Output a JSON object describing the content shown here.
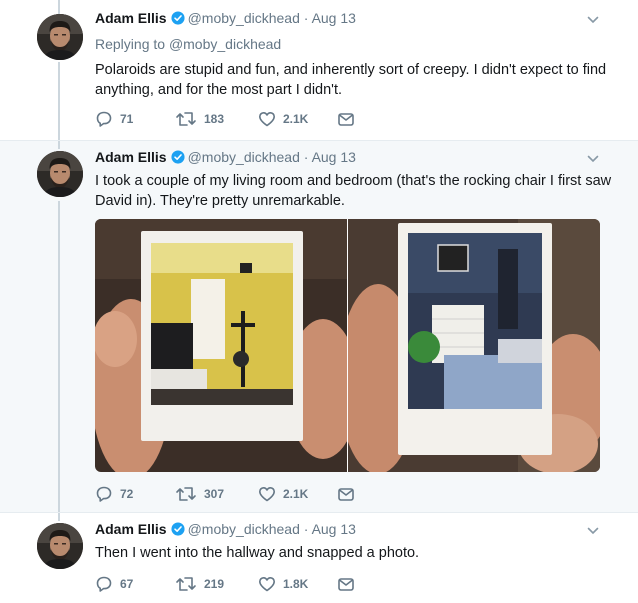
{
  "tweets": [
    {
      "author": "Adam Ellis",
      "handle": "@moby_dickhead",
      "date": "Aug 13",
      "replying_label": "Replying to",
      "replying_handle": "@moby_dickhead",
      "text": "Polaroids are stupid and fun, and inherently sort of creepy. I didn't expect to find anything, and for the most part I didn't.",
      "replies": "71",
      "retweets": "183",
      "likes": "2.1K"
    },
    {
      "author": "Adam Ellis",
      "handle": "@moby_dickhead",
      "date": "Aug 13",
      "text": "I took a couple of my living room and bedroom (that's the rocking chair I first saw David in). They're pretty unremarkable.",
      "replies": "72",
      "retweets": "307",
      "likes": "2.1K",
      "photos": [
        "photo-living-room-polaroid",
        "photo-bedroom-polaroid"
      ]
    },
    {
      "author": "Adam Ellis",
      "handle": "@moby_dickhead",
      "date": "Aug 13",
      "text": "Then I went into the hallway and snapped a photo.",
      "replies": "67",
      "retweets": "219",
      "likes": "1.8K"
    }
  ],
  "separator": "·",
  "icons": [
    "verified-icon",
    "caret-down-icon",
    "reply-icon",
    "retweet-icon",
    "like-icon",
    "direct-message-icon"
  ],
  "colors": {
    "verified": "#1da1f2",
    "secondary_text": "#657786",
    "thread_line": "#ccd6dd",
    "highlight_bg": "#f5f8fa"
  }
}
